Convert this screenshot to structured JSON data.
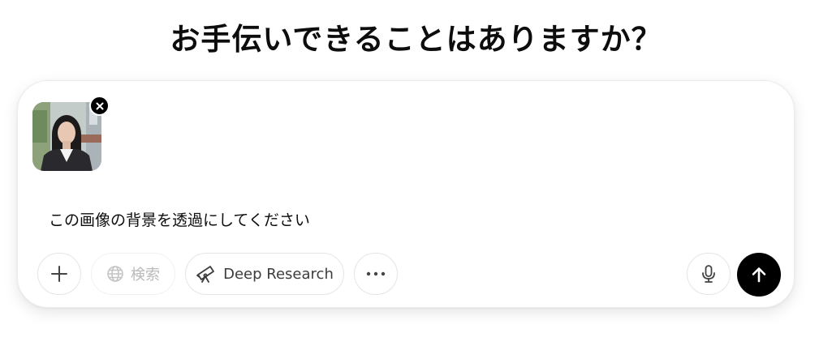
{
  "heading": "お手伝いできることはありますか？",
  "composer": {
    "prompt": "この画像の背景を透過にしてください",
    "attachment": {
      "type": "image",
      "remove_icon": "close-icon"
    }
  },
  "toolbar": {
    "add": {
      "icon": "plus-icon"
    },
    "search": {
      "label": "検索",
      "icon": "globe-icon",
      "state": "disabled"
    },
    "deep_research": {
      "label": "Deep Research",
      "icon": "telescope-icon"
    },
    "more": {
      "icon": "more-horizontal-icon"
    },
    "voice": {
      "icon": "microphone-icon"
    },
    "send": {
      "icon": "arrow-up-icon"
    }
  },
  "colors": {
    "text": "#0d0d0d",
    "disabled_text": "#b9b9b9",
    "send_bg": "#000000",
    "border": "#e5e5e5"
  }
}
